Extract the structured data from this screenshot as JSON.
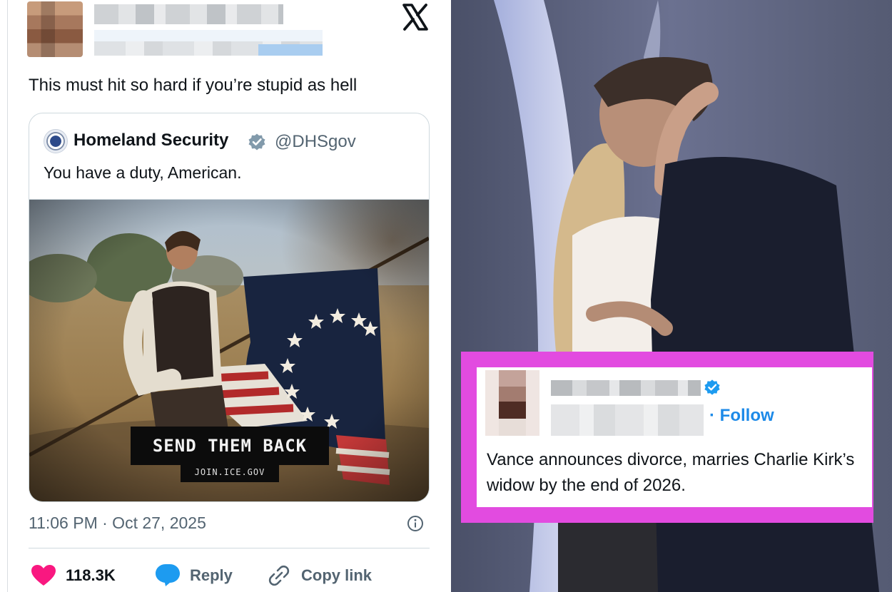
{
  "tweet": {
    "platform_icon": "x-logo-icon",
    "text": "This must hit so hard if you’re stupid as hell",
    "quoted": {
      "account_name": "Homeland Security",
      "handle": "@DHSgov",
      "verified_color": "#829aab",
      "text": "You have a duty, American.",
      "media_caption": "SEND THEM BACK",
      "media_subcaption": "JOIN.ICE.GOV"
    },
    "timestamp": "11:06 PM · Oct 27, 2025",
    "actions": {
      "like_count": "118.3K",
      "reply_label": "Reply",
      "copy_link_label": "Copy link"
    },
    "colors": {
      "like": "#f91880",
      "reply": "#1d9bf0",
      "secondary_text": "#536471"
    }
  },
  "overlay_tweet": {
    "follow_label": "· Follow",
    "verified_color": "#1d9bf0",
    "text": "Vance announces divorce, marries Charlie Kirk’s widow by the end of 2026.",
    "frame_color": "#e24be0"
  }
}
